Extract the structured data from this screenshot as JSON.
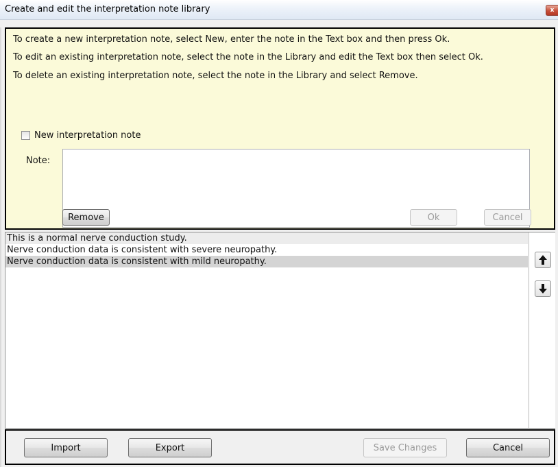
{
  "window": {
    "title": "Create and edit the interpretation note library",
    "close_glyph": "x"
  },
  "instructions": {
    "line1": "To create a new interpretation note, select New, enter the note in the Text box and then press Ok.",
    "line2": "To edit an existing interpretation note, select the note in the Library and edit the Text box then select Ok.",
    "line3": "To delete an existing interpretation note, select the note in the Library and select Remove."
  },
  "new_note": {
    "checkbox_label": "New interpretation note",
    "checked": false
  },
  "note": {
    "label": "Note:",
    "value": ""
  },
  "editor_buttons": {
    "remove": "Remove",
    "ok": "Ok",
    "cancel": "Cancel"
  },
  "library": {
    "items": [
      "This is a normal nerve conduction study.",
      "Nerve conduction data is consistent with severe neuropathy.",
      "Nerve conduction data is consistent with mild neuropathy."
    ],
    "selected_index": 2,
    "move_up_icon": "arrow-up-icon",
    "move_down_icon": "arrow-down-icon"
  },
  "footer": {
    "import": "Import",
    "export": "Export",
    "save_changes": "Save Changes",
    "cancel": "Cancel"
  }
}
